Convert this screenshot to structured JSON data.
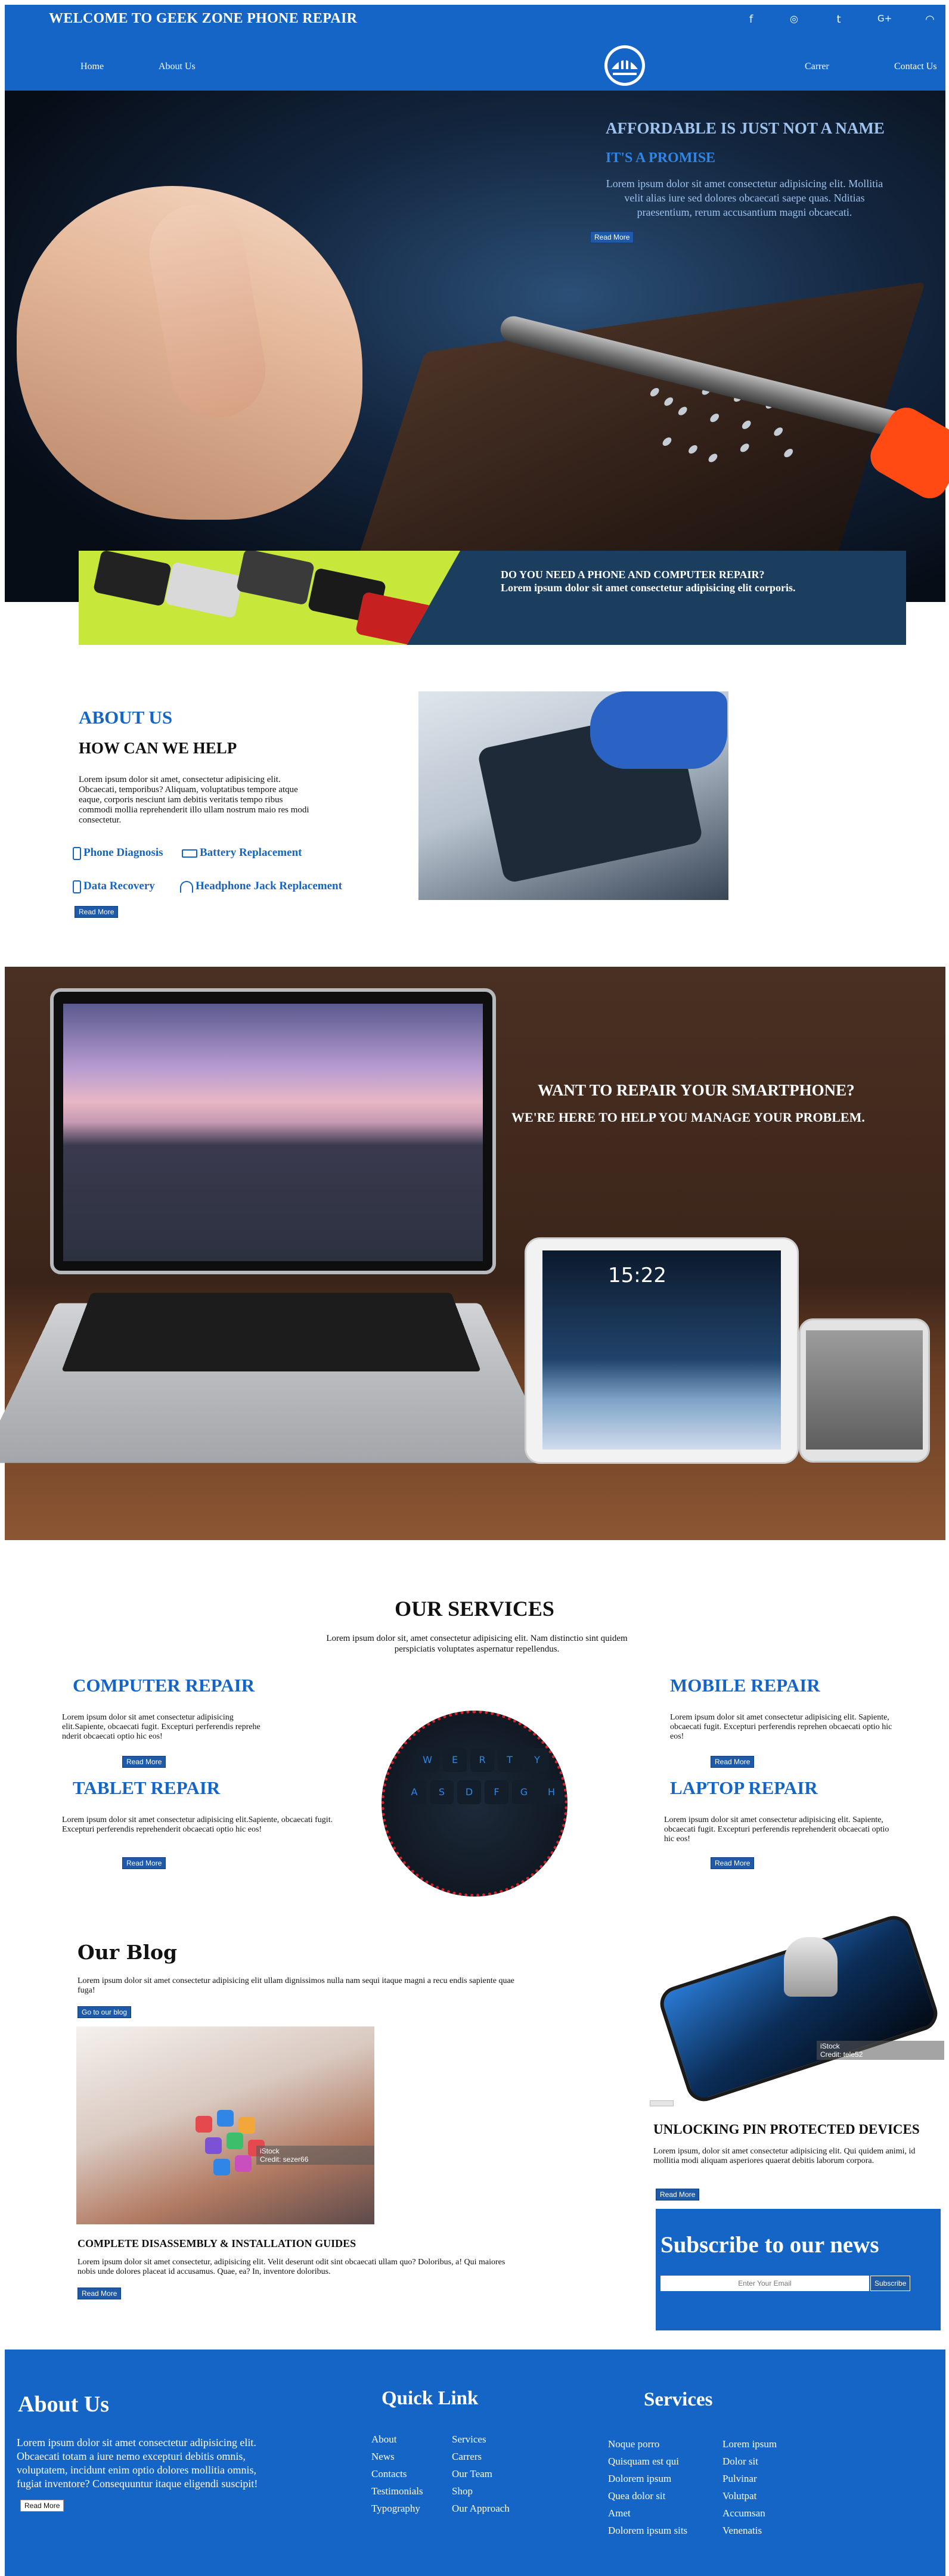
{
  "header": {
    "welcome": "WELCOME TO GEEK ZONE PHONE REPAIR",
    "social_icons": [
      "facebook-icon",
      "instagram-icon",
      "twitter-icon",
      "google-plus-icon",
      "wifi-icon"
    ],
    "social_glyphs": [
      "f",
      "◎",
      "t",
      "G+",
      "◠"
    ]
  },
  "nav": {
    "home": "Home",
    "about": "About Us",
    "career": "Carrer",
    "contact": "Contact Us"
  },
  "hero": {
    "title": "AFFORDABLE IS JUST NOT A NAME",
    "subtitle": "IT'S A PROMISE",
    "text": "Lorem ipsum dolor sit amet consectetur adipisicing elit. Mollitia velit alias iure sed dolores obcaecati saepe quas. Nditias praesentium, rerum accusantium magni obcaecati.",
    "button": "Read More"
  },
  "promo": {
    "title": "DO YOU NEED A PHONE AND COMPUTER REPAIR?",
    "text": "Lorem ipsum dolor sit amet consectetur adipisicing elit corporis."
  },
  "about": {
    "title": "ABOUT US",
    "subtitle": "HOW CAN WE HELP",
    "text": "Lorem ipsum dolor sit amet, consectetur adipisicing elit. Obcaecati, temporibus? Aliquam, voluptatibus tempore atque eaque, corporis nesciunt iam debitis veritatis tempo ribus commodi mollia reprehenderit illo ullam nostrum maio res modi consectetur.",
    "features": [
      "Phone Diagnosis",
      "Battery Replacement",
      "Data Recovery",
      "Headphone Jack Replacement"
    ],
    "button": "Read More"
  },
  "desk": {
    "title": "WANT TO REPAIR YOUR SMARTPHONE?",
    "subtitle": "WE'RE HERE TO HELP YOU MANAGE YOUR PROBLEM.",
    "tablet_time": "15:22"
  },
  "services": {
    "title": "OUR SERVICES",
    "intro": "Lorem ipsum dolor sit, amet consectetur adipisicing elit. Nam distinctio sint quidem perspiciatis voluptates aspernatur repellendus.",
    "items": [
      {
        "title": "COMPUTER REPAIR",
        "text": "Lorem ipsum dolor sit amet consectetur adipisicing elit.Sapiente, obcaecati fugit. Excepturi perferendis reprehe nderit obcaecati optio hic eos!",
        "button": "Read More"
      },
      {
        "title": "MOBILE REPAIR",
        "text": "Lorem ipsum dolor sit amet consectetur adipisicing elit. Sapiente, obcaecati fugit. Excepturi perferendis reprehen obcaecati optio hic eos!",
        "button": "Read More"
      },
      {
        "title": "TABLET REPAIR",
        "text": "Lorem ipsum dolor sit amet consectetur adipisicing elit.Sapiente, obcaecati fugit. Excepturi perferendis reprehenderit obcaecati optio hic eos!",
        "button": "Read More"
      },
      {
        "title": "LAPTOP REPAIR",
        "text": "Lorem ipsum dolor sit amet consectetur adipisicing elit. Sapiente, obcaecati fugit. Excepturi perferendis reprehenderit obcaecati optio hic eos!",
        "button": "Read More"
      }
    ],
    "keys": [
      "W",
      "E",
      "R",
      "T",
      "Y",
      "A",
      "S",
      "D",
      "F",
      "G",
      "H"
    ]
  },
  "blog": {
    "title": "Our Blog",
    "text": "Lorem ipsum dolor sit amet consectetur adipisicing elit ullam dignissimos nulla nam sequi itaque magni a recu endis sapiente quae fuga!",
    "button": "Go to our blog",
    "image_watermark": "iStock",
    "image_credit": "Credit: sezer66",
    "post_title": "COMPLETE DISASSEMBLY & INSTALLATION GUIDES",
    "post_text": "Lorem ipsum dolor sit amet consectetur, adipisicing elit. Velit deserunt odit sint obcaecati ullam quo? Doloribus, a! Qui maiores nobis unde dolores placeat id accusamus. Quae, ea? In, inventore doloribus.",
    "post_button": "Read More"
  },
  "side": {
    "image_watermark": "iStock",
    "image_credit": "Credit: tele52",
    "title": "UNLOCKING PIN PROTECTED DEVICES",
    "text": "Lorem ipsum, dolor sit amet consectetur adipisicing elit. Qui quidem animi, id mollitia modi aliquam asperiores quaerat debitis laborum corpora.",
    "button": "Read More"
  },
  "subscribe": {
    "title": "Subscribe to our news",
    "placeholder": "Enter Your Email",
    "button": "Subscribe"
  },
  "footer": {
    "about_title": "About Us",
    "about_text": "Lorem ipsum dolor sit amet consectetur adipisicing elit. Obcaecati totam a iure nemo excepturi debitis omnis, voluptatem, incidunt enim optio dolores mollitia omnis, fugiat inventore? Consequuntur itaque eligendi suscipit!",
    "about_button": "Read More",
    "quick_title": "Quick Link",
    "quick_col1": [
      "About",
      "News",
      "Contacts",
      "Testimonials",
      "Typography"
    ],
    "quick_col2": [
      "Services",
      "Carrers",
      "Our Team",
      "Shop",
      "Our Approach"
    ],
    "services_title": "Services",
    "services_col1": [
      "Noque porro",
      "Quisquam est qui",
      "Dolorem ipsum",
      "Quea dolor sit",
      "Amet",
      "Dolorem ipsum sits"
    ],
    "services_col2": [
      "Lorem ipsum",
      "Dolor sit",
      "Pulvinar",
      "Volutpat",
      "Accumsan",
      "Venenatis"
    ]
  },
  "colors": {
    "primary": "#1565c6",
    "button": "#1f5aa8",
    "accent_red": "#d3242b",
    "banner": "#1b3d5e"
  }
}
